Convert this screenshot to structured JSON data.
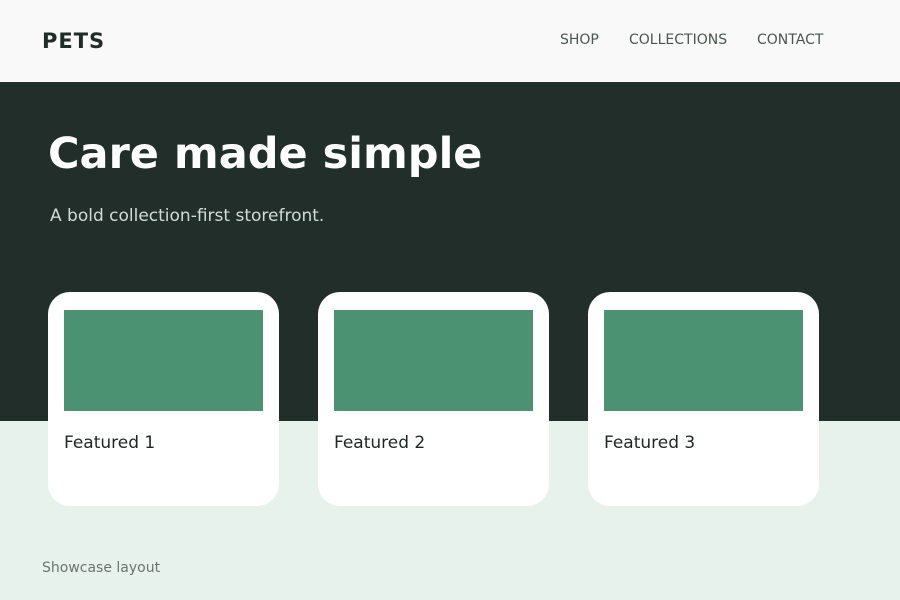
{
  "header": {
    "brand": "PETS",
    "nav": [
      {
        "label": "SHOP"
      },
      {
        "label": "COLLECTIONS"
      },
      {
        "label": "CONTACT"
      }
    ]
  },
  "hero": {
    "title": "Care made simple",
    "subtitle": "A bold collection-first storefront."
  },
  "cards": [
    {
      "title": "Featured 1"
    },
    {
      "title": "Featured 2"
    },
    {
      "title": "Featured 3"
    }
  ],
  "footer": {
    "note": "Showcase layout"
  },
  "colors": {
    "header_bg": "#f9f9f9",
    "hero_bg": "#212e29",
    "page_bg": "#e8f2ed",
    "card_bg": "#ffffff",
    "card_image": "#4a9271"
  }
}
